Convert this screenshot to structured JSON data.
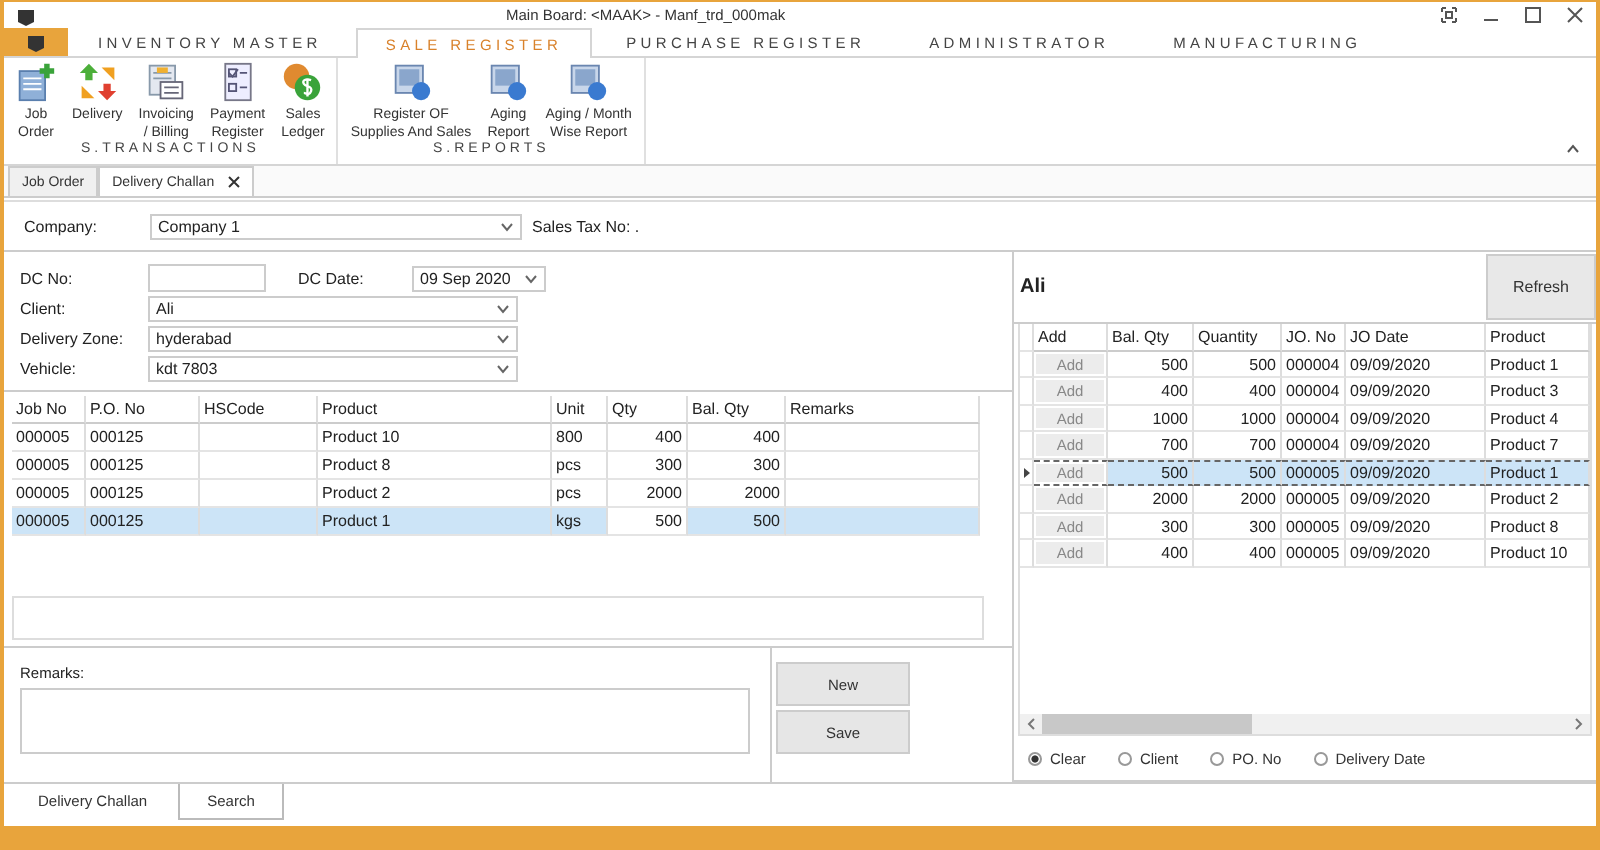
{
  "window": {
    "title": "Main Board: <MAAK> - Manf_trd_000mak"
  },
  "ribbon_tabs": [
    {
      "label": "INVENTORY MASTER",
      "selected": false
    },
    {
      "label": "SALE REGISTER",
      "selected": true
    },
    {
      "label": "PURCHASE REGISTER",
      "selected": false
    },
    {
      "label": "ADMINISTRATOR",
      "selected": false
    },
    {
      "label": "MANUFACTURING",
      "selected": false
    }
  ],
  "ribbon_groups": [
    {
      "title": "S.TRANSACTIONS",
      "items": [
        {
          "kind": "add",
          "lines": [
            "Job",
            "Order"
          ]
        },
        {
          "kind": "arrows",
          "lines": [
            "Delivery"
          ]
        },
        {
          "kind": "invoice",
          "lines": [
            "Invoicing",
            "/ Billing"
          ]
        },
        {
          "kind": "checklist",
          "lines": [
            "Payment",
            "Register"
          ]
        },
        {
          "kind": "coins",
          "lines": [
            "Sales",
            "Ledger"
          ]
        }
      ]
    },
    {
      "title": "S.REPORTS",
      "items": [
        {
          "kind": "report",
          "lines": [
            "Register OF",
            "Supplies And Sales"
          ]
        },
        {
          "kind": "report",
          "lines": [
            "Aging",
            "Report"
          ]
        },
        {
          "kind": "report",
          "lines": [
            "Aging / Month",
            "Wise Report"
          ]
        }
      ]
    }
  ],
  "doc_tabs": [
    {
      "label": "Job Order",
      "selected": false,
      "closable": false
    },
    {
      "label": "Delivery Challan",
      "selected": true,
      "closable": true
    }
  ],
  "company": {
    "label": "Company:",
    "value": "Company 1",
    "tax_label": "Sales Tax No: ."
  },
  "form": {
    "dc_no_label": "DC No:",
    "dc_date_label": "DC Date:",
    "dc_date": "09 Sep 2020",
    "fields": [
      {
        "label": "Client:",
        "value": "Ali"
      },
      {
        "label": "Delivery Zone:",
        "value": "hyderabad"
      },
      {
        "label": "Vehicle:",
        "value": "kdt 7803"
      }
    ]
  },
  "items_table": {
    "columns": [
      "Job No",
      "P.O. No",
      "HSCode",
      "Product",
      "Unit",
      "Qty",
      "Bal. Qty",
      "Remarks"
    ],
    "rows": [
      {
        "cells": [
          "000005",
          "000125",
          "",
          "Product 10",
          "800",
          "400",
          "400",
          ""
        ],
        "selected": false
      },
      {
        "cells": [
          "000005",
          "000125",
          "",
          "Product 8",
          "pcs",
          "300",
          "300",
          ""
        ],
        "selected": false
      },
      {
        "cells": [
          "000005",
          "000125",
          "",
          "Product 2",
          "pcs",
          "2000",
          "2000",
          ""
        ],
        "selected": false
      },
      {
        "cells": [
          "000005",
          "000125",
          "",
          "Product 1",
          "kgs",
          "500",
          "500",
          ""
        ],
        "selected": true
      }
    ]
  },
  "remarks": {
    "label": "Remarks:"
  },
  "buttons": [
    "New",
    "Save"
  ],
  "bottom_tabs": [
    {
      "label": "Delivery Challan",
      "selected": true
    },
    {
      "label": "Search",
      "selected": false
    }
  ],
  "client_panel": {
    "title": "Ali",
    "refresh": "Refresh",
    "columns": [
      "Add",
      "Bal. Qty",
      "Quantity",
      "JO. No",
      "JO Date",
      "Product"
    ],
    "rows": [
      {
        "cells": [
          "Add",
          "500",
          "500",
          "000004",
          "09/09/2020",
          "Product 1"
        ],
        "selected": false
      },
      {
        "cells": [
          "Add",
          "400",
          "400",
          "000004",
          "09/09/2020",
          "Product 3"
        ],
        "selected": false
      },
      {
        "cells": [
          "Add",
          "1000",
          "1000",
          "000004",
          "09/09/2020",
          "Product 4"
        ],
        "selected": false
      },
      {
        "cells": [
          "Add",
          "700",
          "700",
          "000004",
          "09/09/2020",
          "Product 7"
        ],
        "selected": false
      },
      {
        "cells": [
          "Add",
          "500",
          "500",
          "000005",
          "09/09/2020",
          "Product 1"
        ],
        "selected": true
      },
      {
        "cells": [
          "Add",
          "2000",
          "2000",
          "000005",
          "09/09/2020",
          "Product 2"
        ],
        "selected": false
      },
      {
        "cells": [
          "Add",
          "300",
          "300",
          "000005",
          "09/09/2020",
          "Product 8"
        ],
        "selected": false
      },
      {
        "cells": [
          "Add",
          "400",
          "400",
          "000005",
          "09/09/2020",
          "Product 10"
        ],
        "selected": false
      }
    ],
    "filters": [
      {
        "label": "Clear",
        "selected": true
      },
      {
        "label": "Client",
        "selected": false
      },
      {
        "label": "PO. No",
        "selected": false
      },
      {
        "label": "Delivery Date",
        "selected": false
      }
    ]
  }
}
